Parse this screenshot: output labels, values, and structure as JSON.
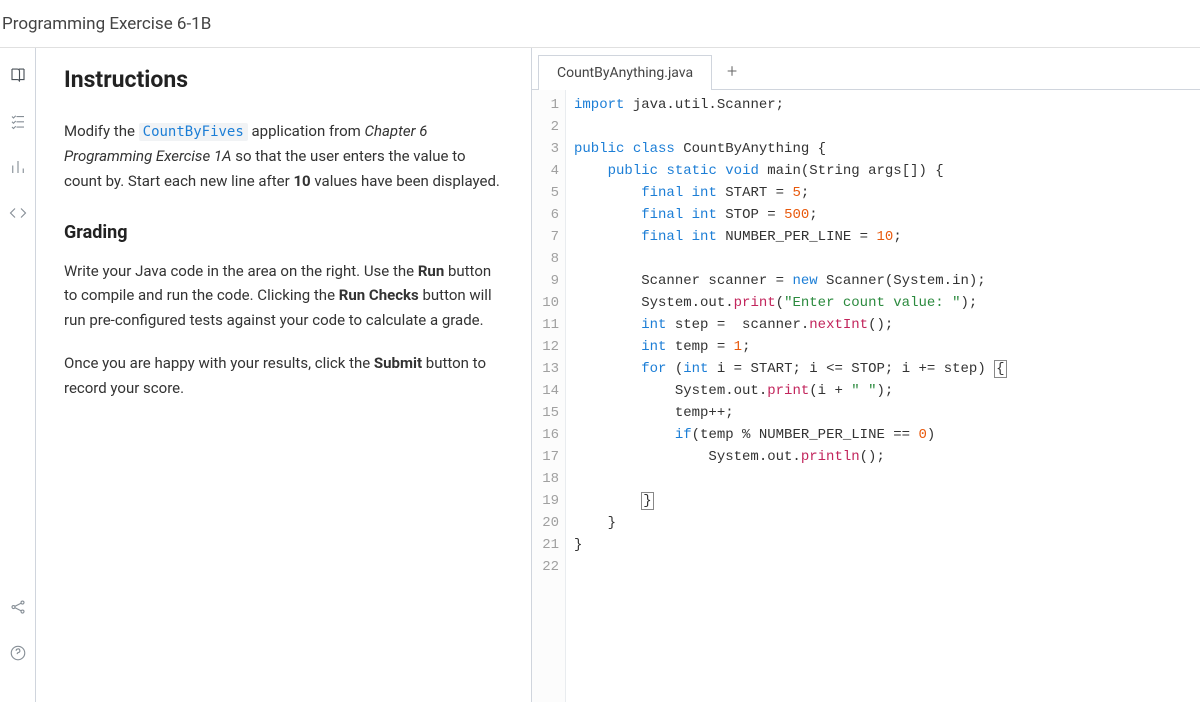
{
  "header": {
    "title": "Programming Exercise 6-1B"
  },
  "sidebar": {
    "icons": [
      "book-icon",
      "checklist-icon",
      "bar-chart-icon",
      "code-icon",
      "share-icon",
      "help-icon"
    ]
  },
  "instructions": {
    "heading": "Instructions",
    "p1_prefix": "Modify the ",
    "p1_code": "CountByFives",
    "p1_mid": " application from ",
    "p1_italic": "Chapter 6 Programming Exercise 1A",
    "p1_suffix": " so that the user enters the value to count by. Start each new line after ",
    "p1_bold": "10",
    "p1_end": " values have been displayed.",
    "grading_heading": "Grading",
    "p2_a": "Write your Java code in the area on the right. Use the ",
    "p2_run": "Run",
    "p2_b": " button to compile and run the code. Clicking the ",
    "p2_runchecks": "Run Checks",
    "p2_c": " button will run pre-configured tests against your code to calculate a grade.",
    "p3_a": "Once you are happy with your results, click the ",
    "p3_submit": "Submit",
    "p3_b": " button to record your score."
  },
  "editor": {
    "tab_name": "CountByAnything.java",
    "line_count": 22,
    "code_lines": [
      {
        "n": 1,
        "t": "import",
        "rest": " java.util.Scanner;"
      },
      {
        "n": 2,
        "blank": true
      },
      {
        "n": 3,
        "raw": "public class CountByAnything {"
      },
      {
        "n": 4,
        "raw": "    public static void main(String args[]) {"
      },
      {
        "n": 5,
        "raw": "        final int START = 5;"
      },
      {
        "n": 6,
        "raw": "        final int STOP = 500;"
      },
      {
        "n": 7,
        "raw": "        final int NUMBER_PER_LINE = 10;"
      },
      {
        "n": 8,
        "blank": true
      },
      {
        "n": 9,
        "raw": "        Scanner scanner = new Scanner(System.in);"
      },
      {
        "n": 10,
        "raw": "        System.out.print(\"Enter count value: \");"
      },
      {
        "n": 11,
        "raw": "        int step =  scanner.nextInt();"
      },
      {
        "n": 12,
        "raw": "        int temp = 1;"
      },
      {
        "n": 13,
        "raw": "        for (int i = START; i <= STOP; i += step) {"
      },
      {
        "n": 14,
        "raw": "            System.out.print(i + \" \");"
      },
      {
        "n": 15,
        "raw": "            temp++;"
      },
      {
        "n": 16,
        "raw": "            if(temp % NUMBER_PER_LINE == 0)"
      },
      {
        "n": 17,
        "raw": "                System.out.println();"
      },
      {
        "n": 18,
        "blank": true
      },
      {
        "n": 19,
        "raw": "        }"
      },
      {
        "n": 20,
        "raw": "    }"
      },
      {
        "n": 21,
        "raw": "}"
      },
      {
        "n": 22,
        "blank": true
      }
    ]
  }
}
